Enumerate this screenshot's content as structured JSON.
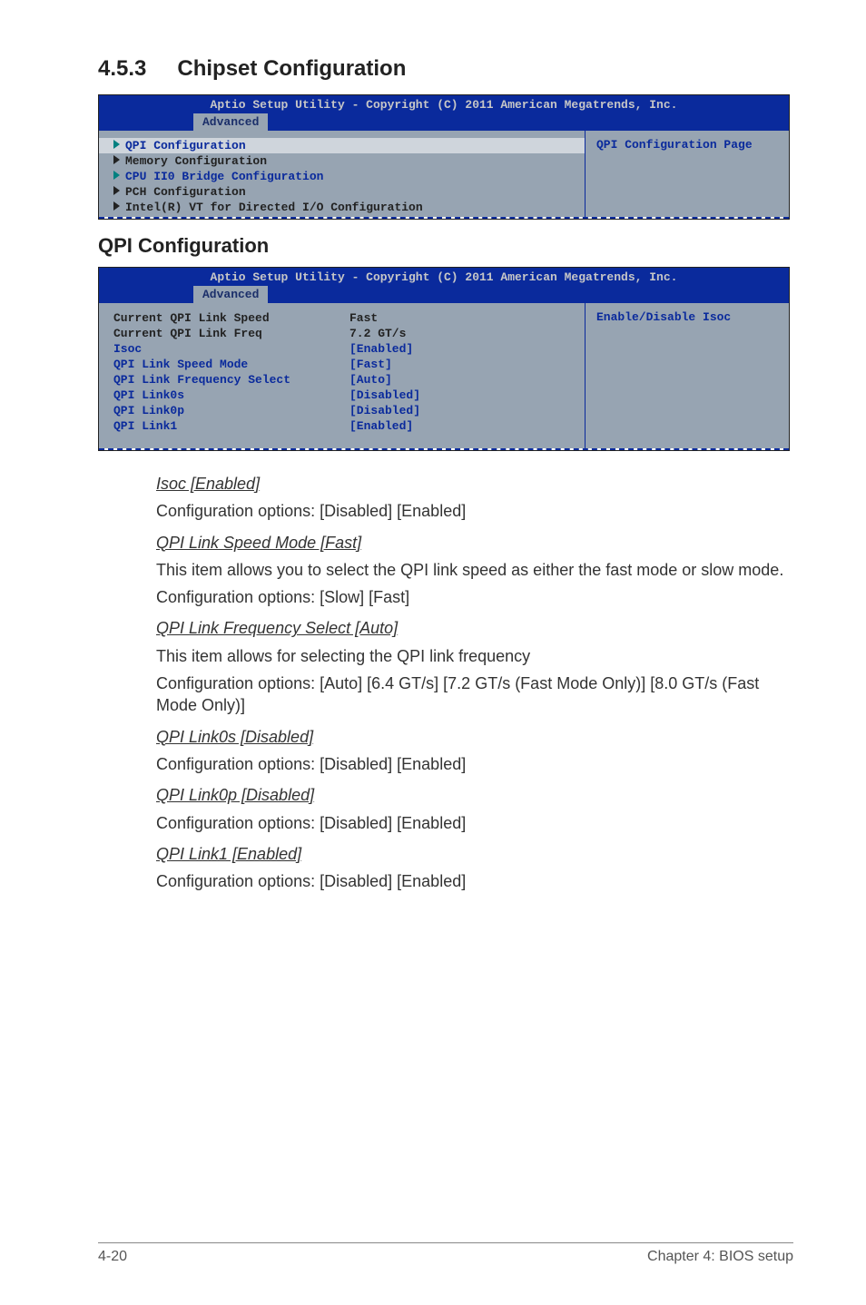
{
  "section": {
    "number": "4.5.3",
    "title": "Chipset Configuration"
  },
  "bios1": {
    "header": "Aptio Setup Utility - Copyright (C) 2011 American Megatrends, Inc.",
    "tab": "Advanced",
    "side": "QPI Configuration Page",
    "items": {
      "i1": "QPI Configuration",
      "i2": "Memory Configuration",
      "i3": "CPU II0 Bridge Configuration",
      "i4": "PCH Configuration",
      "i5": "Intel(R) VT for Directed I/O Configuration"
    }
  },
  "sub": {
    "title": "QPI Configuration"
  },
  "bios2": {
    "header": "Aptio Setup Utility - Copyright (C) 2011 American Megatrends, Inc.",
    "tab": "Advanced",
    "side": "Enable/Disable Isoc",
    "rows": {
      "r1l": "Current QPI Link Speed",
      "r1v": "Fast",
      "r2l": "Current QPI Link Freq",
      "r2v": "7.2 GT/s",
      "r3l": "Isoc",
      "r3v": "[Enabled]",
      "r4l": "QPI Link Speed Mode",
      "r4v": "[Fast]",
      "r5l": "QPI Link Frequency Select",
      "r5v": "[Auto]",
      "r6l": "QPI Link0s",
      "r6v": "[Disabled]",
      "r7l": "QPI Link0p",
      "r7v": "[Disabled]",
      "r8l": "QPI Link1",
      "r8v": "[Enabled]"
    }
  },
  "text": {
    "isoc_h": "Isoc [Enabled]",
    "isoc_p": "Configuration options: [Disabled] [Enabled]",
    "speed_h": "QPI Link Speed Mode [Fast]",
    "speed_p1": "This item allows you to select the QPI link speed as either the fast mode or slow mode.",
    "speed_p2": "Configuration options: [Slow] [Fast]",
    "freq_h": "QPI Link Frequency Select [Auto]",
    "freq_p1": "This item allows for selecting the QPI link frequency",
    "freq_p2": "Configuration options: [Auto] [6.4 GT/s] [7.2 GT/s (Fast Mode Only)] [8.0 GT/s (Fast Mode Only)]",
    "l0s_h": "QPI Link0s [Disabled]",
    "l0s_p": "Configuration options: [Disabled] [Enabled]",
    "l0p_h": "QPI Link0p [Disabled]",
    "l0p_p": "Configuration options: [Disabled] [Enabled]",
    "l1_h": "QPI Link1 [Enabled]",
    "l1_p": "Configuration options: [Disabled] [Enabled]"
  },
  "footer": {
    "left": "4-20",
    "right": "Chapter 4: BIOS setup"
  }
}
